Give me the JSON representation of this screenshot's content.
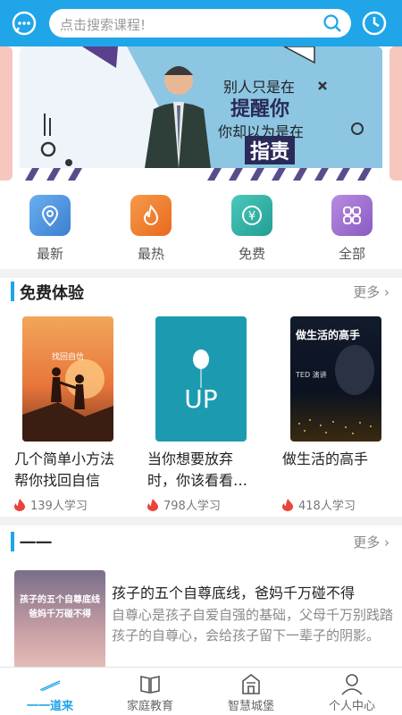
{
  "header": {
    "search_placeholder": "点击搜索课程!"
  },
  "banner": {
    "line1": "别人只是在",
    "line2": "提醒你",
    "line3": "你却以为是在",
    "line4": "指责"
  },
  "categories": [
    {
      "label": "最新",
      "icon": "location-pin-icon",
      "color": "#4f8fd6"
    },
    {
      "label": "最热",
      "icon": "flame-icon",
      "color": "#f07a2a"
    },
    {
      "label": "免费",
      "icon": "yen-coin-icon",
      "color": "#2ab5a8"
    },
    {
      "label": "全部",
      "icon": "grid-icon",
      "color": "#9b6bc9"
    }
  ],
  "free_section": {
    "title": "免费体验",
    "more": "更多",
    "courses": [
      {
        "title": "几个简单小方法帮你找回自信",
        "learners": "139人学习",
        "cover_text": "找回自信"
      },
      {
        "title": "当你想要放弃时，你该看看…",
        "learners": "798人学习",
        "cover_text": "UP"
      },
      {
        "title": "做生活的高手",
        "learners": "418人学习",
        "cover_text": "做生活的高手",
        "cover_sub": "TED 演讲"
      }
    ]
  },
  "section2": {
    "title": "一一",
    "more": "更多",
    "article": {
      "title": "孩子的五个自尊底线，爸妈千万碰不得",
      "desc": "自尊心是孩子自爱自强的基础，父母千万别践踏孩子的自尊心，会给孩子留下一辈子的阴影。",
      "img_text_1": "孩子的五个自尊底线",
      "img_text_2": "爸妈千万碰不得"
    }
  },
  "tabs": [
    {
      "label": "一一道来",
      "icon": "home-icon",
      "active": true
    },
    {
      "label": "家庭教育",
      "icon": "book-icon",
      "active": false
    },
    {
      "label": "智慧城堡",
      "icon": "castle-icon",
      "active": false
    },
    {
      "label": "个人中心",
      "icon": "person-icon",
      "active": false
    }
  ],
  "colors": {
    "brand": "#1fa5e8",
    "fire": "#e8443a"
  }
}
